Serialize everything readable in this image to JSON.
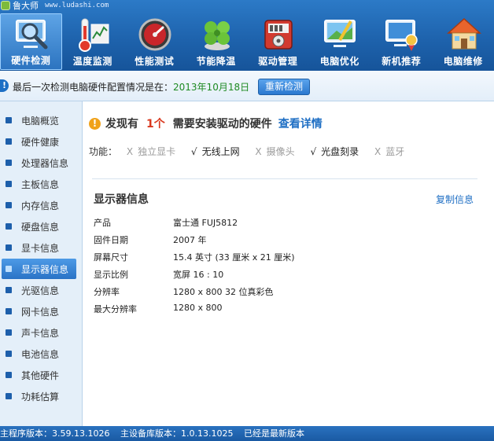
{
  "app": {
    "name": "鲁大师",
    "url": "www.ludashi.com"
  },
  "nav": [
    {
      "label": "硬件检测",
      "icon": "magnifier-monitor-icon",
      "active": true
    },
    {
      "label": "温度监测",
      "icon": "thermometer-icon",
      "active": false
    },
    {
      "label": "性能测试",
      "icon": "speedometer-icon",
      "active": false
    },
    {
      "label": "节能降温",
      "icon": "clover-leaf-icon",
      "active": false
    },
    {
      "label": "驱动管理",
      "icon": "driver-box-icon",
      "active": false
    },
    {
      "label": "电脑优化",
      "icon": "broom-monitor-icon",
      "active": false
    },
    {
      "label": "新机推荐",
      "icon": "monitor-medal-icon",
      "active": false
    },
    {
      "label": "电脑维修",
      "icon": "house-icon",
      "active": false
    }
  ],
  "notice": {
    "message": "最后一次检测电脑硬件配置情况是在：",
    "date": "2013年10月18日",
    "recheck_label": "重新检测"
  },
  "sidebar": {
    "items": [
      {
        "label": "电脑概览"
      },
      {
        "label": "硬件健康"
      },
      {
        "label": "处理器信息"
      },
      {
        "label": "主板信息"
      },
      {
        "label": "内存信息"
      },
      {
        "label": "硬盘信息"
      },
      {
        "label": "显卡信息"
      },
      {
        "label": "显示器信息",
        "active": true
      },
      {
        "label": "光驱信息"
      },
      {
        "label": "网卡信息"
      },
      {
        "label": "声卡信息"
      },
      {
        "label": "电池信息"
      },
      {
        "label": "其他硬件"
      },
      {
        "label": "功耗估算"
      }
    ]
  },
  "main": {
    "found_prefix": "发现有",
    "found_count": "1个",
    "found_suffix": "需要安装驱动的硬件",
    "detail_link": "查看详情",
    "features_title": "功能：",
    "features": [
      {
        "mark": "X",
        "label": "独立显卡",
        "enabled": false
      },
      {
        "mark": "√",
        "label": "无线上网",
        "enabled": true
      },
      {
        "mark": "X",
        "label": "摄像头",
        "enabled": false
      },
      {
        "mark": "√",
        "label": "光盘刻录",
        "enabled": true
      },
      {
        "mark": "X",
        "label": "蓝牙",
        "enabled": false
      }
    ],
    "section_title": "显示器信息",
    "copy_link": "复制信息",
    "rows": [
      {
        "key": "产品",
        "value": "富士通 FUJ5812"
      },
      {
        "key": "固件日期",
        "value": "2007 年"
      },
      {
        "key": "屏幕尺寸",
        "value": "15.4 英寸 (33 厘米 x 21 厘米)"
      },
      {
        "key": "显示比例",
        "value": "宽屏 16 : 10"
      },
      {
        "key": "分辨率",
        "value": "1280 x 800 32 位真彩色"
      },
      {
        "key": "最大分辨率",
        "value": "1280 x 800"
      }
    ]
  },
  "status": {
    "program_version": "主程序版本：3.59.13.1026",
    "device_db_version": "主设备库版本：1.0.13.1025",
    "latest": "已经是最新版本"
  },
  "colors": {
    "accent": "#1e63ad",
    "warning": "#d9381e",
    "link": "#1f6fc4",
    "date": "#1e8a22"
  }
}
